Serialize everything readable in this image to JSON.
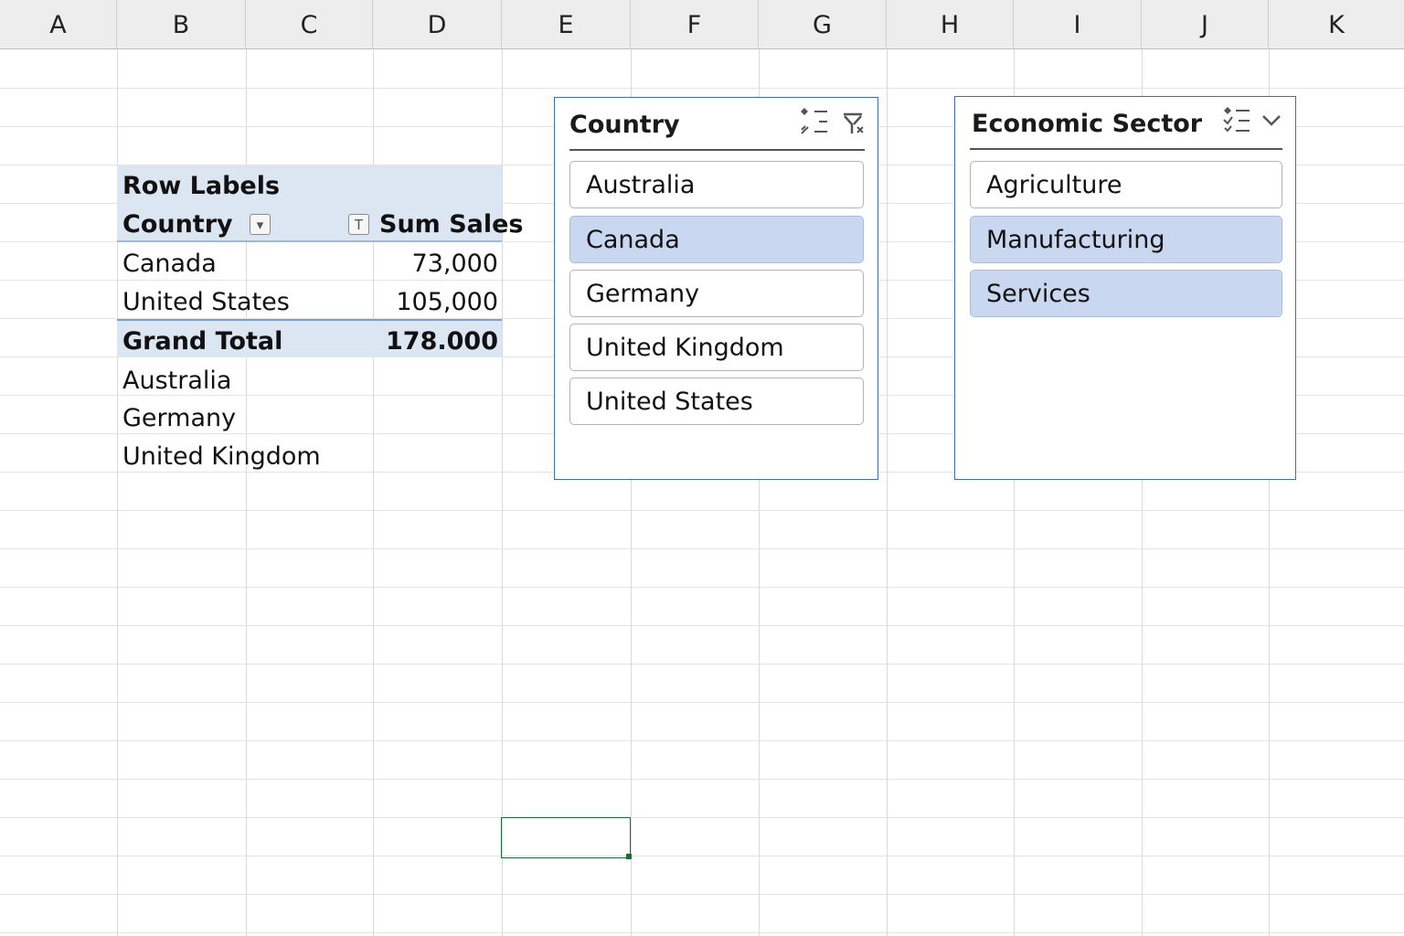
{
  "columns": [
    "A",
    "B",
    "C",
    "D",
    "E",
    "F",
    "G",
    "H",
    "I",
    "J",
    "K"
  ],
  "pivot": {
    "row_labels_header": "Row Labels",
    "country_header": "Country",
    "filter_button_glyph": "▾",
    "sum_header_button_glyph": "T",
    "sum_header": "Sum Sales",
    "rows": [
      {
        "label": "Canada",
        "value": "73,000"
      },
      {
        "label": "United States",
        "value": "105,000"
      }
    ],
    "grand_total_label": "Grand Total",
    "grand_total_value": "178.000",
    "extra_rows": [
      "Australia",
      "Germany",
      "United Kingdom"
    ],
    "band_color": "#dce6f2"
  },
  "slicer_country": {
    "title": "Country",
    "icons": [
      "multi-select-icon",
      "clear-filter-icon"
    ],
    "items": [
      {
        "label": "Australia",
        "selected": false
      },
      {
        "label": "Canada",
        "selected": true
      },
      {
        "label": "Germany",
        "selected": false
      },
      {
        "label": "United Kingdom",
        "selected": false
      },
      {
        "label": "United States",
        "selected": false
      }
    ]
  },
  "slicer_sector": {
    "title": "Economic Sector",
    "icons": [
      "multi-select-icon",
      "chevron-down-icon"
    ],
    "items": [
      {
        "label": "Agriculture",
        "selected": false
      },
      {
        "label": "Manufacturing",
        "selected": true
      },
      {
        "label": "Services",
        "selected": true
      }
    ]
  },
  "colors": {
    "selected_item": "#c9d8f0",
    "slicer_border": "#3a6fbf",
    "active_cell_border": "#1e6b3a"
  }
}
